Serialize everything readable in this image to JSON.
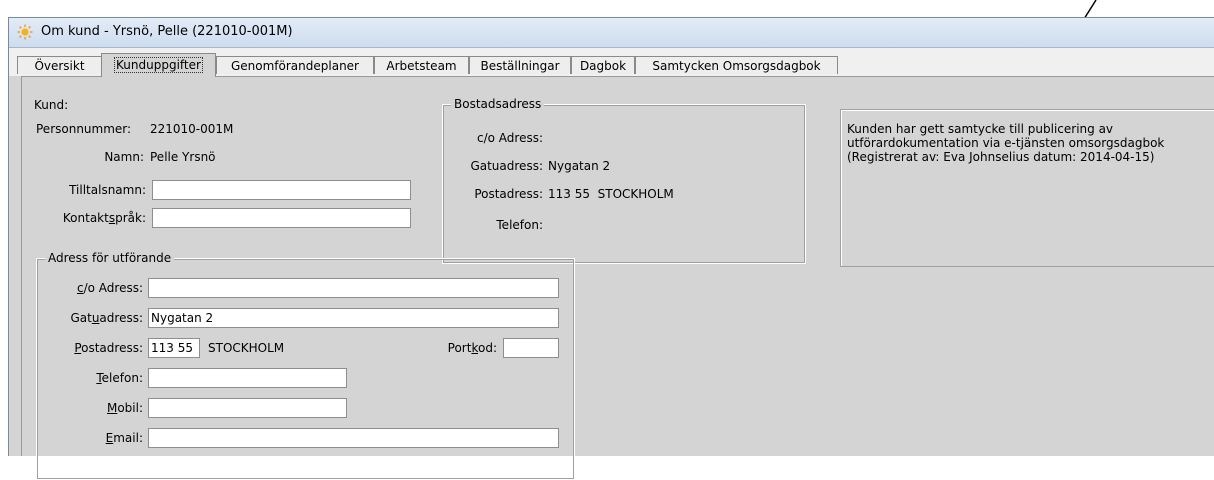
{
  "window": {
    "title": "Om kund - Yrsnö, Pelle (221010-001M)"
  },
  "tabs": [
    {
      "label": "Översikt"
    },
    {
      "label": "Kunduppgifter"
    },
    {
      "label": "Genomförandeplaner"
    },
    {
      "label": "Arbetsteam"
    },
    {
      "label": "Beställningar"
    },
    {
      "label": "Dagbok"
    },
    {
      "label": "Samtycken Omsorgsdagbok"
    }
  ],
  "kund": {
    "heading": "Kund:",
    "personnummer_label": "Personnummer:",
    "personnummer": "221010-001M",
    "namn_label": "Namn:",
    "namn": "Pelle Yrsnö",
    "tilltalsnamn_label": "Tilltalsnamn:",
    "tilltalsnamn": "",
    "kontaktsprak_label": "Kontaktspråk:",
    "kontaktsprak": ""
  },
  "bostadsadress": {
    "title": "Bostadsadress",
    "co_label": "c/o Adress:",
    "co": "",
    "gatuadress_label": "Gatuadress:",
    "gatuadress": "Nygatan 2",
    "postadress_label": "Postadress:",
    "postadress": "113 55  STOCKHOLM",
    "telefon_label": "Telefon:",
    "telefon": ""
  },
  "utforande": {
    "title": "Adress för utförande",
    "co_label": "c/o Adress:",
    "co": "",
    "gatuadress_label": "Gatuadress:",
    "gatuadress": "Nygatan 2",
    "postadress_label": "Postadress:",
    "postnummer": "113 55",
    "postort": "STOCKHOLM",
    "portkod_label": "Portkod:",
    "portkod": "",
    "telefon_label": "Telefon:",
    "telefon": "",
    "mobil_label": "Mobil:",
    "mobil": "",
    "email_label": "Email:",
    "email": ""
  },
  "samtycke": {
    "line1": "Kunden har gett samtycke till publicering av",
    "line2": "utförardokumentation via e-tjänsten omsorgsdagbok",
    "line3": "(Registrerat av: Eva Johnselius datum: 2014-04-15)"
  },
  "colors": {
    "titlebar": "#dbe6f4",
    "panel": "#d4d4d4",
    "arrow": "#000000"
  }
}
